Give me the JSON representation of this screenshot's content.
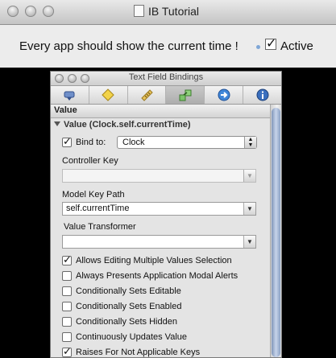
{
  "app": {
    "title": "IB Tutorial",
    "label": "Every app should show the current time !",
    "active_label": "Active"
  },
  "inspector": {
    "title": "Text Field Bindings",
    "toolbar": [
      "attributes-icon",
      "effects-icon",
      "size-icon",
      "bindings-icon",
      "connections-icon",
      "info-icon"
    ],
    "section": "Value",
    "subsection": "Value (Clock.self.currentTime)",
    "bind_to_label": "Bind to:",
    "bind_to_value": "Clock",
    "controller_key_label": "Controller Key",
    "controller_key_value": "",
    "model_key_path_label": "Model Key Path",
    "model_key_path_value": "self.currentTime",
    "value_transformer_label": "Value Transformer",
    "value_transformer_value": "",
    "options": [
      {
        "label": "Allows Editing Multiple Values Selection",
        "checked": true
      },
      {
        "label": "Always Presents Application Modal Alerts",
        "checked": false
      },
      {
        "label": "Conditionally Sets Editable",
        "checked": false
      },
      {
        "label": "Conditionally Sets Enabled",
        "checked": false
      },
      {
        "label": "Conditionally Sets Hidden",
        "checked": false
      },
      {
        "label": "Continuously Updates Value",
        "checked": false
      },
      {
        "label": "Raises For Not Applicable Keys",
        "checked": true
      }
    ]
  }
}
